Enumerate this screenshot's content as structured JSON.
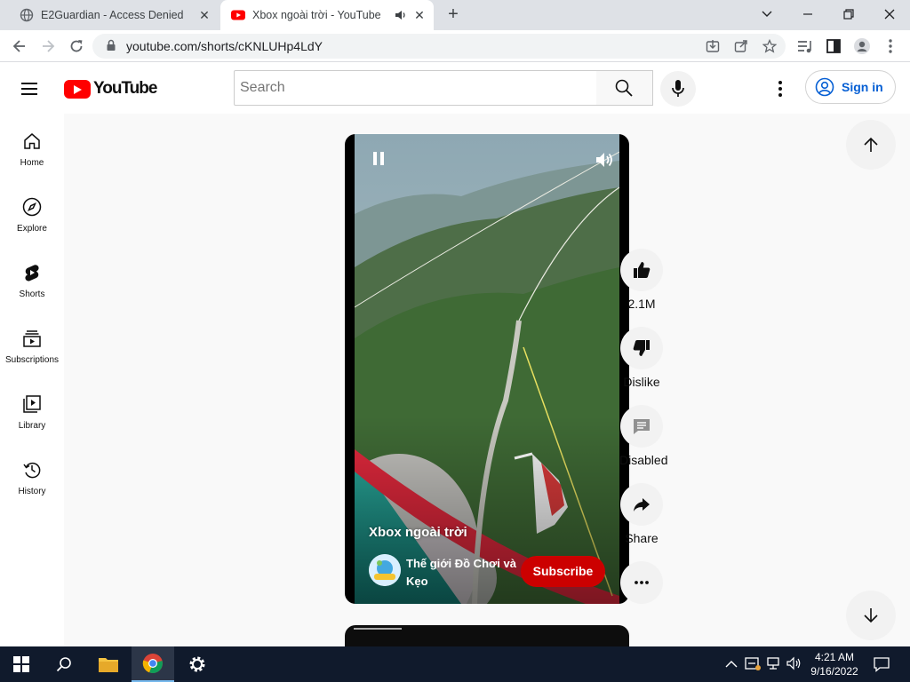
{
  "browser": {
    "tabs": [
      {
        "title": "E2Guardian - Access Denied",
        "active": false
      },
      {
        "title": "Xbox ngoài trời - YouTube",
        "active": true
      }
    ],
    "url": "youtube.com/shorts/cKNLUHp4LdY"
  },
  "youtube": {
    "logo_text": "YouTube",
    "search_placeholder": "Search",
    "signin_label": "Sign in",
    "sidebar": [
      {
        "label": "Home",
        "icon": "home-icon"
      },
      {
        "label": "Explore",
        "icon": "compass-icon"
      },
      {
        "label": "Shorts",
        "icon": "shorts-icon"
      },
      {
        "label": "Subscriptions",
        "icon": "subscriptions-icon"
      },
      {
        "label": "Library",
        "icon": "library-icon"
      },
      {
        "label": "History",
        "icon": "history-icon"
      }
    ],
    "short": {
      "title": "Xbox ngoài trời",
      "channel": "Thế giới Đồ Chơi và Kẹo",
      "subscribe_label": "Subscribe"
    },
    "actions": {
      "like_count": "2.1M",
      "dislike_label": "Dislike",
      "comments_label": "Disabled",
      "share_label": "Share"
    }
  },
  "taskbar": {
    "time": "4:21 AM",
    "date": "9/16/2022"
  },
  "colors": {
    "brand_red": "#ff0000",
    "subscribe_red": "#cc0000",
    "link_blue": "#065fd4",
    "taskbar": "#101a2c"
  }
}
